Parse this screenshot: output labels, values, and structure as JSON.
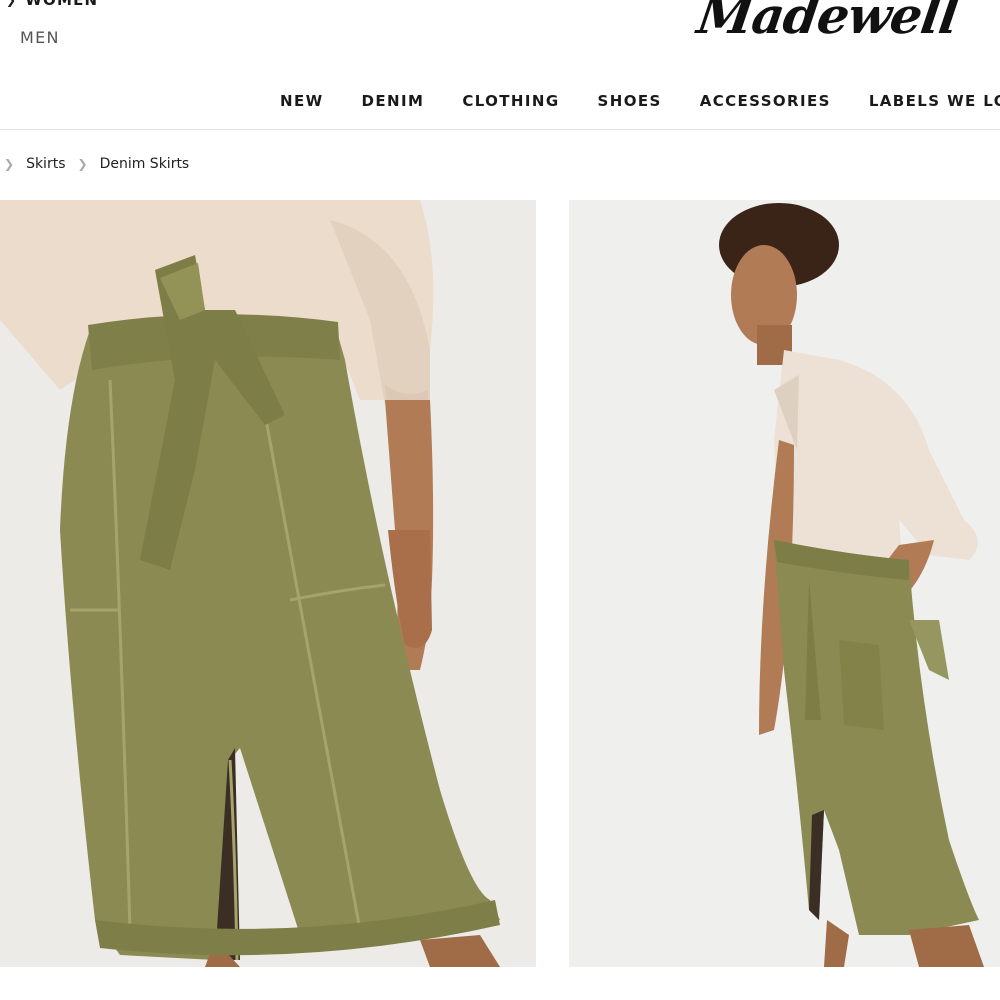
{
  "header": {
    "gender_women": "WOMEN",
    "gender_men": "MEN",
    "logo_text": "Madewell"
  },
  "nav": {
    "items": [
      "NEW",
      "DENIM",
      "CLOTHING",
      "SHOES",
      "ACCESSORIES",
      "LABELS WE LOVE"
    ]
  },
  "breadcrumb": {
    "items": [
      "Skirts",
      "Denim Skirts"
    ]
  },
  "colors": {
    "skirt_olive": "#8a8a52",
    "sweater_cream": "#ecdccb",
    "skin": "#b07b55",
    "hair": "#3a2418"
  },
  "icons": {
    "chevron": "chevron-right-icon"
  }
}
